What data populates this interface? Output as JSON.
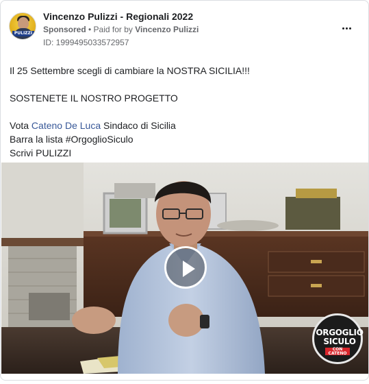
{
  "ad": {
    "page_name": "Vincenzo Pulizzi - Regionali 2022",
    "sponsored_label": "Sponsored",
    "separator": " • ",
    "paid_for_prefix": "Paid for by ",
    "paid_for_name": "Vincenzo Pulizzi",
    "ad_id": "ID: 1999495033572957",
    "avatar_tag": "PULIZZI"
  },
  "post": {
    "line1": "Il 25 Settembre scegli di cambiare la NOSTRA SICILIA!!!",
    "line2": "SOSTENETE IL NOSTRO PROGETTO",
    "line3_prefix": "Vota ",
    "line3_link": "Cateno De Luca",
    "line3_suffix": " Sindaco di Sicilia",
    "line4": "Barra la lista #OrgoglioSiculo",
    "line5": "Scrivi PULIZZI"
  },
  "video": {
    "logo_line1": "ORGOGLIO",
    "logo_line2": "SICULO",
    "logo_line3": "CON CATENO"
  },
  "colors": {
    "link": "#385898",
    "meta_text": "#65676b",
    "primary_text": "#1c1e21"
  },
  "icons": {
    "more": "more-options-icon",
    "play": "play-icon"
  }
}
